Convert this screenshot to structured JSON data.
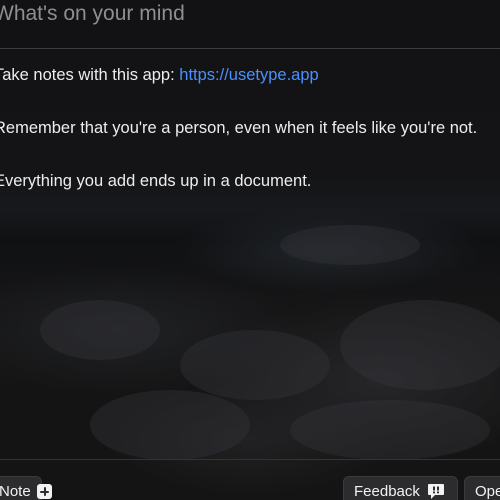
{
  "editor": {
    "placeholder": "What's on your mind",
    "notes": [
      {
        "text": "Take notes with this app: ",
        "link": "https://usetype.app"
      },
      {
        "text": "Remember that you're a person, even when it feels like you're not."
      },
      {
        "text": "Everything you add ends up in a document."
      }
    ]
  },
  "footer": {
    "left_button": {
      "label": "Note",
      "icon": "plus-icon"
    },
    "feedback_button": {
      "label": "Feedback",
      "icon": "speech-bubble-icon"
    },
    "right_button": {
      "label": "Open"
    }
  },
  "colors": {
    "link": "#4a90ff",
    "placeholder": "#8e8e93",
    "text": "#ededed",
    "button_bg": "#2c2c2e"
  }
}
